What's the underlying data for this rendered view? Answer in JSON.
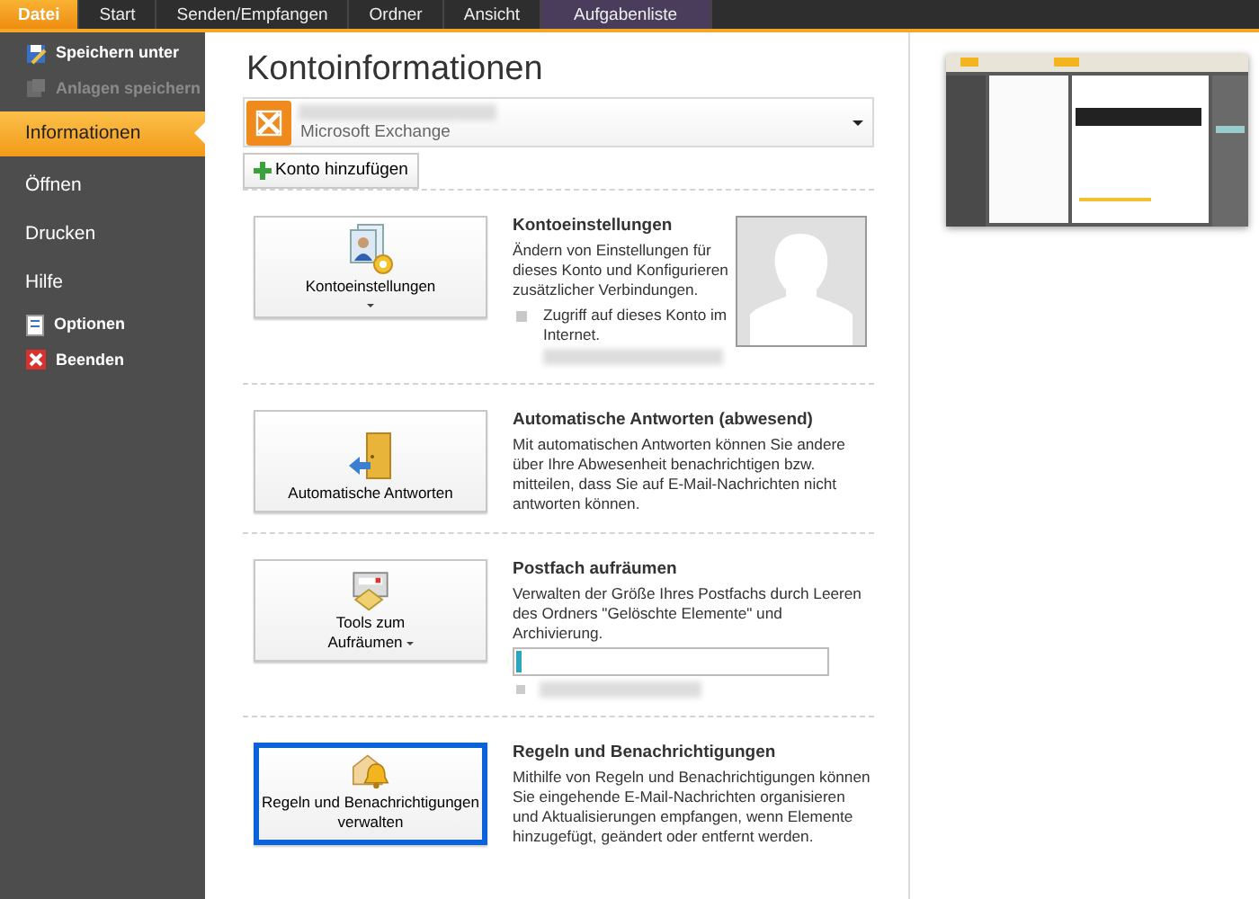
{
  "ribbon_tabs": [
    {
      "label": "Datei",
      "selected": true,
      "kind": "file"
    },
    {
      "label": "Start",
      "selected": false,
      "kind": "normal"
    },
    {
      "label": "Senden/Empfangen",
      "selected": false,
      "kind": "normal"
    },
    {
      "label": "Ordner",
      "selected": false,
      "kind": "normal"
    },
    {
      "label": "Ansicht",
      "selected": false,
      "kind": "normal"
    },
    {
      "label": "Aufgabenliste",
      "selected": false,
      "kind": "contextual"
    }
  ],
  "sidebar": {
    "items": [
      {
        "label": "Speichern unter",
        "kind": "saveas",
        "selected": false,
        "disabled": false
      },
      {
        "label": "Anlagen speichern",
        "kind": "attachments",
        "selected": false,
        "disabled": true
      },
      {
        "label": "Informationen",
        "kind": "section",
        "selected": true,
        "disabled": false
      },
      {
        "label": "Öffnen",
        "kind": "section",
        "selected": false,
        "disabled": false
      },
      {
        "label": "Drucken",
        "kind": "section",
        "selected": false,
        "disabled": false
      },
      {
        "label": "Hilfe",
        "kind": "section",
        "selected": false,
        "disabled": false
      },
      {
        "label": "Optionen",
        "kind": "options",
        "selected": false,
        "disabled": false
      },
      {
        "label": "Beenden",
        "kind": "exit",
        "selected": false,
        "disabled": false
      }
    ]
  },
  "page": {
    "title": "Kontoinformationen",
    "account": {
      "type": "Microsoft Exchange"
    },
    "add_account_button": "Konto hinzufügen",
    "sections": [
      {
        "kind": "account",
        "button": "Kontoeinstellungen",
        "selected": false,
        "title": "Kontoeinstellungen",
        "description": "Ändern von Einstellungen für dieses Konto und Konfigurieren zusätzlicher Verbindungen.",
        "bullet": "Zugriff auf dieses Konto im Internet."
      },
      {
        "kind": "autoreply",
        "button": "Automatische Antworten",
        "selected": false,
        "title": "Automatische Antworten (abwesend)",
        "description": "Mit automatischen Antworten können Sie andere über Ihre Abwesenheit benachrichtigen bzw. mitteilen, dass Sie auf E-Mail-Nachrichten nicht antworten können."
      },
      {
        "kind": "cleanup",
        "button": "Tools zum Aufräumen",
        "selected": false,
        "title": "Postfach aufräumen",
        "description": "Verwalten der Größe Ihres Postfachs durch Leeren des Ordners \"Gelöschte Elemente\" und Archivierung.",
        "level": 0.015
      },
      {
        "kind": "rules",
        "button": "Regeln und Benachrichtigungen verwalten",
        "selected": true,
        "title": "Regeln und Benachrichtigungen",
        "description": "Mithilfe von Regeln und Benachrichtigungen können Sie eingehende E-Mail-Nachrichten organisieren und Aktualisierungen empfangen, wenn Elemente hinzugefügt, geändert oder entfernt werden."
      }
    ]
  }
}
